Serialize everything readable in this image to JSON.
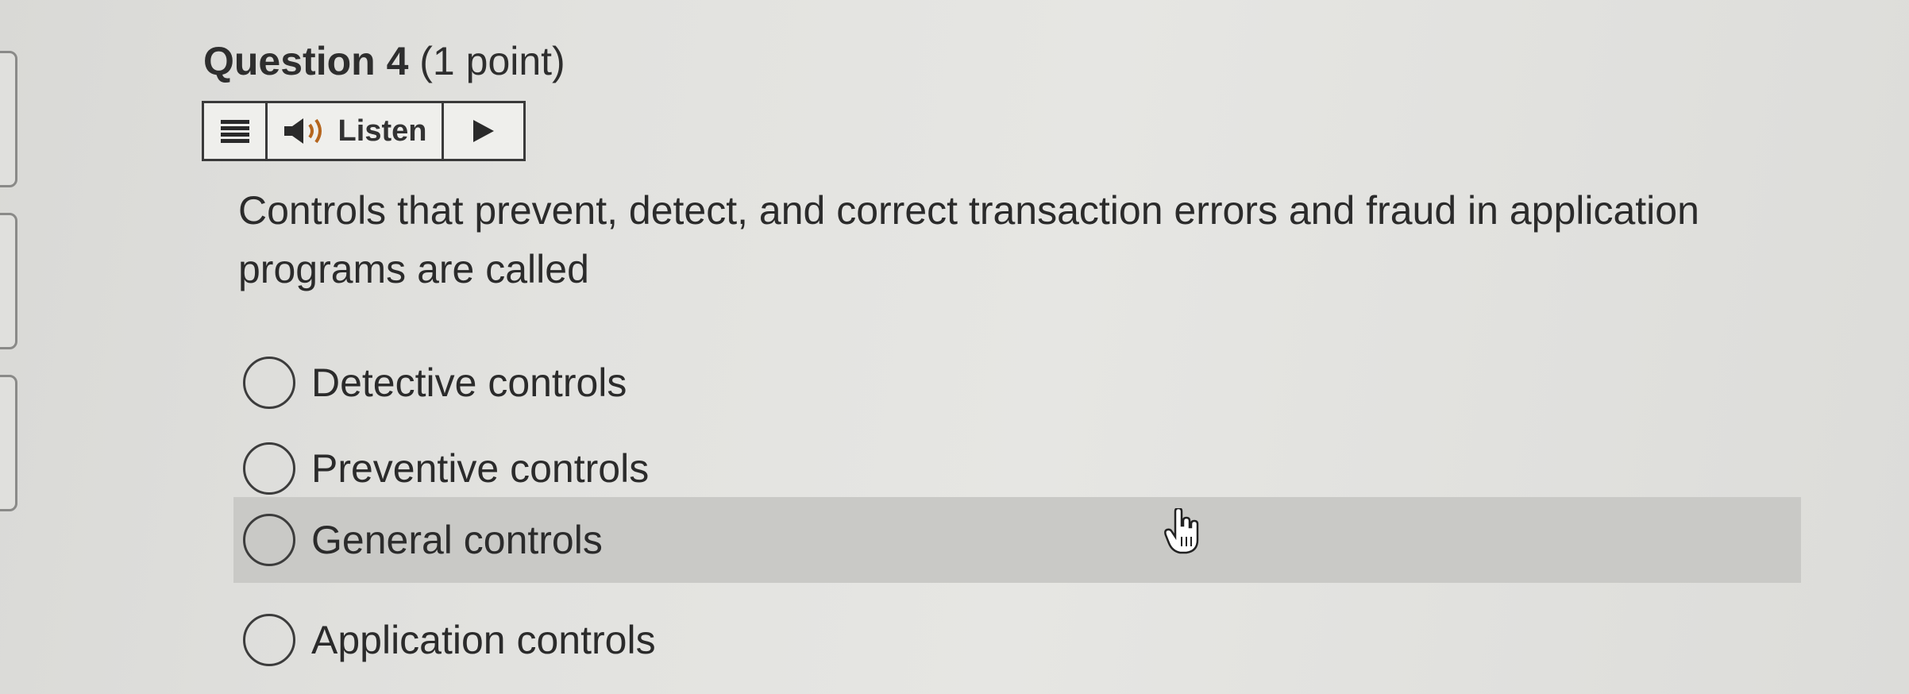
{
  "question": {
    "title": "Question 4",
    "points": "(1 point)",
    "prompt": "Controls that prevent, detect, and correct transaction errors and fraud in application programs are called"
  },
  "toolbar": {
    "menu_icon": "menu-icon",
    "speaker_icon": "speaker-icon",
    "listen_label": "Listen",
    "play_icon": "play-icon"
  },
  "options": [
    {
      "label": "Detective controls",
      "selected": false
    },
    {
      "label": "Preventive controls",
      "selected": false
    },
    {
      "label": "General controls",
      "selected": false,
      "hovered": true
    },
    {
      "label": "Application controls",
      "selected": false
    }
  ],
  "colors": {
    "background": "#e2e2df",
    "hover_row": "#c9c9c6",
    "text": "#2b2b2b",
    "border": "#3a3a3a"
  }
}
